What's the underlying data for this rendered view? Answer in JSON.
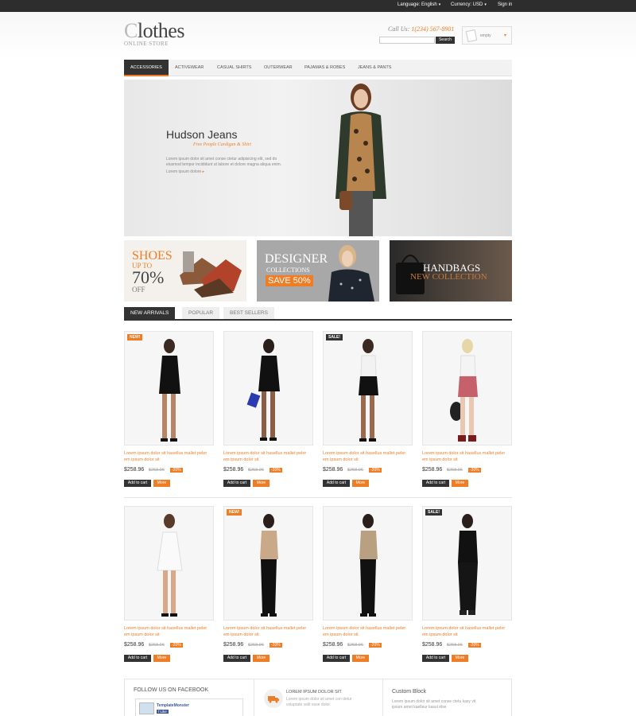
{
  "topbar": {
    "language": "Language: English",
    "currency": "Currency: USD",
    "signin": "Sign in"
  },
  "header": {
    "logo_first": "C",
    "logo_rest": "lothes",
    "logo_sub": "ONLINE STORE",
    "call_label": "Call Us:",
    "call_number": "1(234) 567-8901",
    "search_placeholder": "",
    "search_button": "Search",
    "cart_label": "empty"
  },
  "nav": {
    "items": [
      "ACCESSORIES",
      "ACTIVEWEAR",
      "CASUAL SHIRTS",
      "OUTERWEAR",
      "PAJAMAS & ROBES",
      "JEANS & PANTS"
    ]
  },
  "banner": {
    "title": "Hudson Jeans",
    "tagline": "Free People Cardigan & Shirt",
    "description": "Lorem ipsum dolor sit amet conse ctetur adipisicing elit, sed do eiusmod tempor incididunt ut labore et dolore magna aliqua enim.",
    "more": "Lorem ipsum dolore"
  },
  "promos": {
    "shoes": {
      "title": "SHOES",
      "upto": "UP TO",
      "pct": "70%",
      "off": "OFF"
    },
    "designer": {
      "title": "DESIGNER",
      "sub": "COLLECTIONS",
      "save": "SAVE 50%"
    },
    "handbags": {
      "title": "HANDBAGS",
      "sub": "NEW COLLECTION"
    }
  },
  "product_tabs": [
    "NEW ARRIVALS",
    "POPULAR",
    "BEST SELLERS"
  ],
  "products": [
    {
      "badge": "NEW!",
      "name": "Lorem ipsum dolor sit hasellus mallet peler em ipsum dolor sit",
      "price": "$258.96",
      "old": "$258.96",
      "disc": "-20%"
    },
    {
      "badge": "",
      "name": "Lorem ipsum dolor sit hasellus mallet peler em ipsum dolor sit",
      "price": "$258.96",
      "old": "$258.96",
      "disc": "-20%"
    },
    {
      "badge": "SALE!",
      "name": "Lorem ipsum dolor sit hasellus mallet peler em ipsum dolor sit",
      "price": "$258.96",
      "old": "$258.96",
      "disc": "-20%"
    },
    {
      "badge": "",
      "name": "Lorem ipsum dolor sit hasellus mallet peler em ipsum dolor sit",
      "price": "$258.96",
      "old": "$258.96",
      "disc": "-20%"
    },
    {
      "badge": "",
      "name": "Lorem ipsum dolor sit hasellus mallet peler em ipsum dolor sit",
      "price": "$258.96",
      "old": "$258.96",
      "disc": "-20%"
    },
    {
      "badge": "NEW!",
      "name": "Lorem ipsum dolor sit hasellus mallet peler em ipsum dolor sit",
      "price": "$258.96",
      "old": "$258.96",
      "disc": "-20%"
    },
    {
      "badge": "",
      "name": "Lorem ipsum dolor sit hasellus mallet peler em ipsum dolor sit",
      "price": "$258.96",
      "old": "$258.96",
      "disc": "-20%"
    },
    {
      "badge": "SALE!",
      "name": "Lorem ipsum dolor sit hasellus mallet peler em ipsum dolor sit",
      "price": "$258.96",
      "old": "$258.96",
      "disc": "-20%"
    }
  ],
  "buttons": {
    "add_to_cart": "Add to cart",
    "more": "More"
  },
  "footer": {
    "facebook_title": "FOLLOW US ON FACEBOOK",
    "fb_name": "TemplateMonster",
    "fb_like": "Like",
    "col2_title": "LOREM IPSUM DOLOR SIT",
    "col2_text": "Lorem ipsum dolor sit amet con detur voluptate velit esse dolor.",
    "col3_title": "Custom Block",
    "col3_text": "Lorem ipsum dolor sit amet conse ctetu kasy vit ipsum amet kaelleur kasul else"
  },
  "colors": {
    "accent": "#ef7d26",
    "dark": "#333333",
    "topbar": "#2d2d2d"
  }
}
